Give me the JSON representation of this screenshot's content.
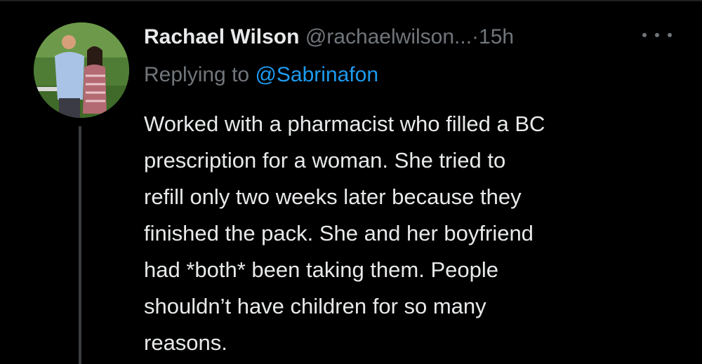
{
  "tweet": {
    "author": {
      "display_name": "Rachael Wilson",
      "handle": "@rachaelwilson...",
      "avatar_icon": "profile-photo"
    },
    "separator": "·",
    "timestamp": "15h",
    "more_icon": "more-horizontal-icon",
    "reply": {
      "prefix": "Replying to",
      "mention": "@Sabrinafon"
    },
    "body_lines": [
      "Worked with a pharmacist who filled a BC",
      "prescription for a woman. She tried to",
      "refill only two weeks later because they",
      "finished the pack. She and her boyfriend",
      "had *both* been taking them. People",
      "shouldn’t have children for so many",
      "reasons."
    ]
  },
  "colors": {
    "background": "#000000",
    "text_primary": "#e7e9ea",
    "text_secondary": "#71767b",
    "link": "#1d9bf0",
    "thread_line": "#3a3d40"
  }
}
